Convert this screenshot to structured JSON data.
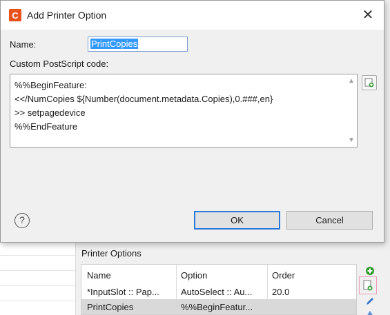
{
  "dialog": {
    "app_icon_letter": "C",
    "title": "Add Printer Option",
    "close_glyph": "✕",
    "name_label": "Name:",
    "name_value": "PrintCopies",
    "code_label": "Custom PostScript code:",
    "code_lines": [
      "%%BeginFeature:",
      "<</NumCopies ${Number(document.metadata.Copies),0.###,en}",
      ">> setpagedevice",
      "%%EndFeature"
    ],
    "help_glyph": "?",
    "ok_label": "OK",
    "cancel_label": "Cancel"
  },
  "printer_options": {
    "title": "Printer Options",
    "columns": [
      "Name",
      "Option",
      "Order"
    ],
    "rows": [
      [
        "*InputSlot :: Pap...",
        "AutoSelect :: Au...",
        "20.0"
      ],
      [
        "PrintCopies",
        "%%BeginFeatur...",
        ""
      ]
    ]
  },
  "icons": {
    "app": "app-logo-icon",
    "close": "close-icon",
    "insert": "insert-variable-icon",
    "help": "help-icon",
    "add": "add-icon",
    "new": "new-option-icon",
    "edit": "edit-icon",
    "move": "move-icon"
  },
  "colors": {
    "brand": "#e8501c",
    "selection": "#3399ff",
    "ok_border": "#2b7ad8",
    "add_green": "#2e9b2e",
    "highlight_pink": "#f29ab8"
  }
}
